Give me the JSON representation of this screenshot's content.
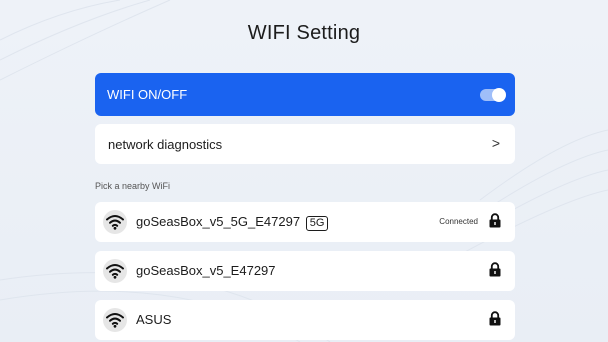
{
  "page": {
    "title": "WIFI Setting"
  },
  "wifi_toggle": {
    "label": "WIFI ON/OFF",
    "on": true
  },
  "diagnostics": {
    "label": "network diagnostics",
    "chevron": ">"
  },
  "networks_section": {
    "label": "Pick a nearby WiFi"
  },
  "networks": [
    {
      "ssid": "goSeasBox_v5_5G_E47297",
      "band_badge": "5G",
      "status": "Connected",
      "secured": true,
      "icon": "wifi-icon"
    },
    {
      "ssid": "goSeasBox_v5_E47297",
      "band_badge": "",
      "status": "",
      "secured": true,
      "icon": "wifi-icon"
    },
    {
      "ssid": "ASUS",
      "band_badge": "",
      "status": "",
      "secured": true,
      "icon": "wifi-icon"
    }
  ],
  "colors": {
    "accent": "#1a63f0",
    "background": "#eef2f8",
    "card": "#ffffff"
  }
}
